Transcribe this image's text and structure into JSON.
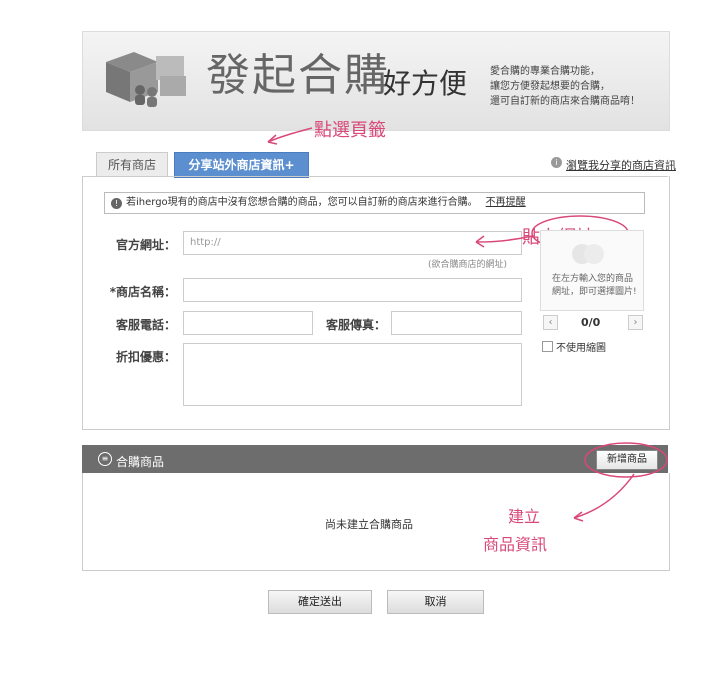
{
  "banner": {
    "title_main": "發起合購",
    "title_sub": "好方便",
    "description": "愛合購的專業合購功能，\n讓您方便發起想要的合購，\n還可自訂新的商店來合購商品唷！"
  },
  "annotations": {
    "tab_hint": "點選頁籤",
    "url_hint": "貼上網址",
    "product_hint_line1": "建立",
    "product_hint_line2": "商品資訊"
  },
  "tabs": [
    {
      "label": "所有商店"
    },
    {
      "label": "分享站外商店資訊+"
    }
  ],
  "browse_link": "瀏覽我分享的商店資訊",
  "notice": {
    "text": "若ihergo現有的商店中沒有您想合購的商品，您可以自訂新的商店來進行合購。",
    "dismiss": "不再提醒"
  },
  "form": {
    "url_label": "官方網址：",
    "url_placeholder": "http://",
    "url_hint": "(欲合購商店的網址)",
    "name_label": "*商店名稱：",
    "phone_label": "客服電話：",
    "fax_label": "客服傳真：",
    "discount_label": "折扣優惠："
  },
  "preview": {
    "text": "在左方輸入您的商品\n網址，即可選擇圖片!",
    "counter": "0/0",
    "no_thumb_label": "不使用縮圖"
  },
  "products": {
    "title": "合購商品",
    "add_button": "新增商品",
    "empty_text": "尚未建立合購商品"
  },
  "actions": {
    "submit": "確定送出",
    "cancel": "取消"
  },
  "colors": {
    "tab_active": "#5c8fcf",
    "annotation": "#d9487a",
    "product_header": "#6d6d6d"
  }
}
